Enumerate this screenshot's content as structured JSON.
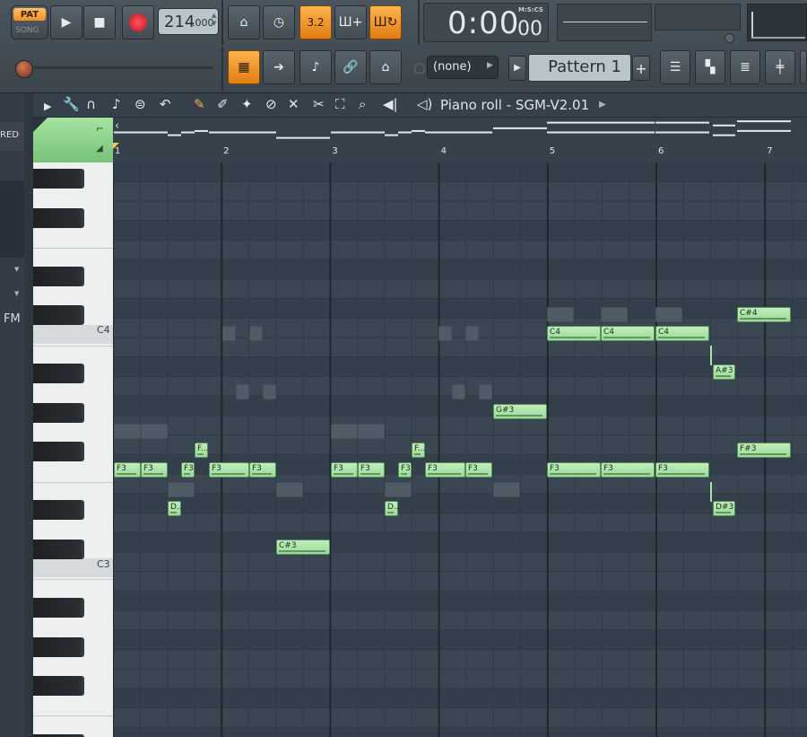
{
  "transport": {
    "pat_label": "PAT",
    "song_label": "SONG",
    "tempo_int": "214",
    "tempo_dec": ".000",
    "time_main": "0:00",
    "time_sub": "00",
    "time_unit": "M:S:CS"
  },
  "toolbar": {
    "pattern_selector": "(none)",
    "pattern_name": "Pattern 1",
    "add_label": "+",
    "icons": [
      "metronome-icon",
      "tempo-clock-icon",
      "step-edit-icon",
      "typing-keyboard-icon",
      "loop-record-icon",
      "playlist-icon",
      "channel-rack-icon",
      "piano-roll-icon",
      "browser-icon",
      "mixer-icon"
    ]
  },
  "sidebar": {
    "red_label": "RED",
    "fm_label": "FM"
  },
  "piano_roll": {
    "title": "Piano roll - SGM-V2.01",
    "bars": [
      "1",
      "2",
      "3",
      "4",
      "5",
      "6",
      "7"
    ],
    "key_labels": {
      "c4": "C4",
      "c3": "C3"
    },
    "notes": [
      {
        "label": "F3"
      },
      {
        "label": "F3"
      },
      {
        "label": "F3"
      },
      {
        "label": "F..."
      },
      {
        "label": "D..."
      },
      {
        "label": "F3"
      },
      {
        "label": "F3"
      },
      {
        "label": "C#3"
      },
      {
        "label": "F3"
      },
      {
        "label": "F3"
      },
      {
        "label": "F3"
      },
      {
        "label": "F..."
      },
      {
        "label": "D..."
      },
      {
        "label": "F3"
      },
      {
        "label": "F3"
      },
      {
        "label": "G#3"
      },
      {
        "label": "C4"
      },
      {
        "label": "C4"
      },
      {
        "label": "C4"
      },
      {
        "label": "F3"
      },
      {
        "label": "F3"
      },
      {
        "label": "F3"
      },
      {
        "label": "A#3"
      },
      {
        "label": "D#3"
      },
      {
        "label": "C#4"
      },
      {
        "label": "F#3"
      }
    ]
  }
}
